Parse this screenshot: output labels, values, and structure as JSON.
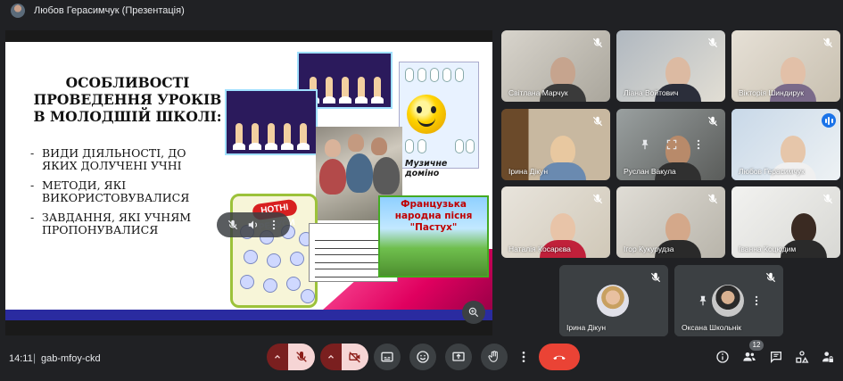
{
  "window": {
    "title": "Любов Герасимчук (Презентація)"
  },
  "slide": {
    "title": "ОСОБЛИВОСТІ ПРОВЕДЕННЯ УРОКІВ В МОЛОДШІЙ ШКОЛІ:",
    "bullets": [
      "ВИДИ ДІЯЛЬНОСТІ, ДО ЯКИХ ДОЛУЧЕНІ УЧНІ",
      "МЕТОДИ, ЯКІ ВИКОРИСТОВУВАЛИСЯ",
      "ЗАВДАННЯ, ЯКІ УЧНЯМ ПРОПОНУВАЛИСЯ"
    ],
    "domino_label": "Музичне доміно",
    "rebus_label": "НОТНІ РЕБУСИ",
    "folk_label": "Французька народна пісня \"Пастух\""
  },
  "participants": [
    {
      "name": "Світлана Марчук",
      "muted": true
    },
    {
      "name": "Ліана Войтович",
      "muted": true
    },
    {
      "name": "Вікторія Шиндирук",
      "muted": true
    },
    {
      "name": "Ірина Дікун",
      "muted": true
    },
    {
      "name": "Руслан Вакула",
      "muted": true
    },
    {
      "name": "Любов Герасимчук",
      "muted": false,
      "speaking": true
    },
    {
      "name": "Наталія Косарєва",
      "muted": true
    },
    {
      "name": "Ігор Кукурудза",
      "muted": true
    },
    {
      "name": "Іванна Коцюдим",
      "muted": true
    },
    {
      "name": "Ірина Дікун",
      "muted": true
    },
    {
      "name": "Оксана Школьнік",
      "muted": true
    }
  ],
  "meeting": {
    "time": "14:11",
    "separator": "|",
    "code": "gab-mfoy-ckd",
    "participant_count": "12"
  },
  "colors": {
    "background": "#202124",
    "end_call": "#ea4335",
    "mic_off": "#f6d5d5",
    "active_speaker": "#1a73e8"
  }
}
